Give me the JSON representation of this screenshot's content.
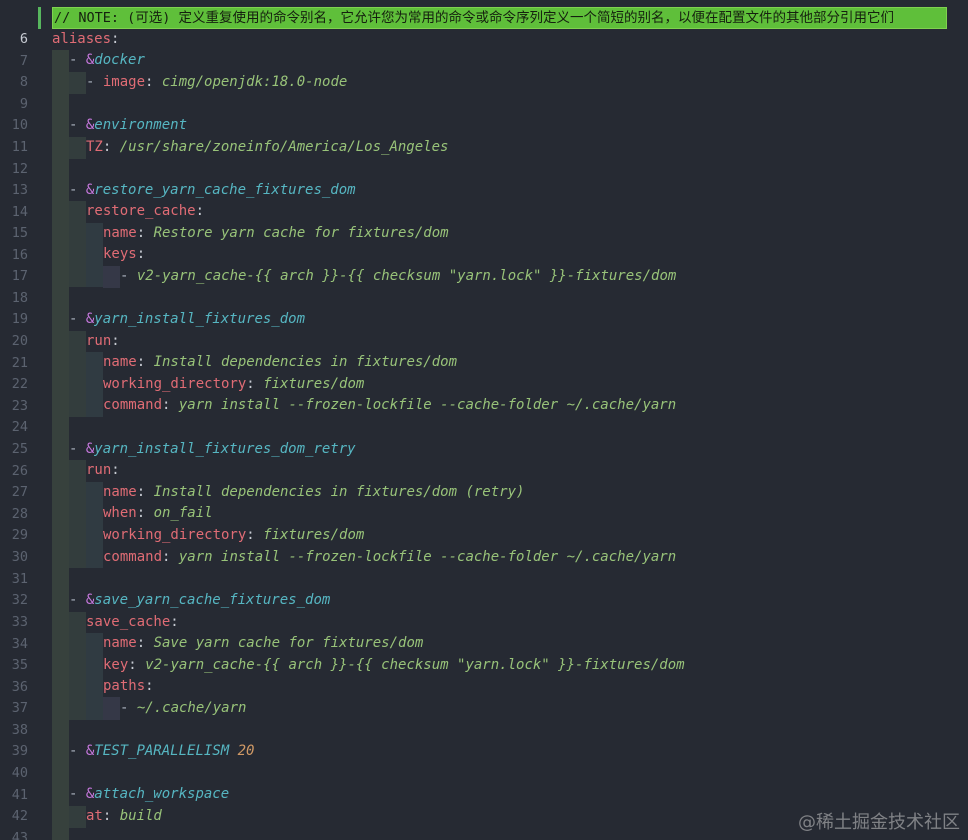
{
  "editor": {
    "note_line": "// NOTE: (可选) 定义重复使用的命令别名，它允许您为常用的命令或命令序列定义一个简短的别名，以便在配置文件的其他部分引用它们",
    "line_numbers": [
      "6",
      "7",
      "8",
      "9",
      "10",
      "11",
      "12",
      "13",
      "14",
      "15",
      "16",
      "17",
      "18",
      "19",
      "20",
      "21",
      "22",
      "23",
      "24",
      "25",
      "26",
      "27",
      "28",
      "29",
      "30",
      "31",
      "32",
      "33",
      "34",
      "35",
      "36",
      "37",
      "38",
      "39",
      "40",
      "41",
      "42",
      "43",
      "44"
    ],
    "colors": {
      "background": "#262a33",
      "key": "#e06c75",
      "anchor_sigil": "#c678dd",
      "anchor_name": "#56b6c2",
      "string": "#98c379",
      "number": "#d19a66",
      "note_highlight": "#5fbf3a"
    }
  },
  "code": {
    "l7": {
      "key": "aliases",
      "colon": ":"
    },
    "l8": {
      "dash": "- ",
      "amp": "&",
      "anchor": "docker"
    },
    "l9": {
      "dash": "- ",
      "key": "image",
      "colon": ": ",
      "value": "cimg/openjdk:18.0-node"
    },
    "l11": {
      "dash": "- ",
      "amp": "&",
      "anchor": "environment"
    },
    "l12": {
      "key": "TZ",
      "colon": ": ",
      "value": "/usr/share/zoneinfo/America/Los_Angeles"
    },
    "l14": {
      "dash": "- ",
      "amp": "&",
      "anchor": "restore_yarn_cache_fixtures_dom"
    },
    "l15": {
      "key": "restore_cache",
      "colon": ":"
    },
    "l16": {
      "key": "name",
      "colon": ": ",
      "value": "Restore yarn cache for fixtures/dom"
    },
    "l17": {
      "key": "keys",
      "colon": ":"
    },
    "l18": {
      "dash": "- ",
      "value": "v2-yarn_cache-{{ arch }}-{{ checksum \"yarn.lock\" }}-fixtures/dom"
    },
    "l20": {
      "dash": "- ",
      "amp": "&",
      "anchor": "yarn_install_fixtures_dom"
    },
    "l21": {
      "key": "run",
      "colon": ":"
    },
    "l22": {
      "key": "name",
      "colon": ": ",
      "value": "Install dependencies in fixtures/dom"
    },
    "l23": {
      "key": "working_directory",
      "colon": ": ",
      "value": "fixtures/dom"
    },
    "l24": {
      "key": "command",
      "colon": ": ",
      "value": "yarn install --frozen-lockfile --cache-folder ~/.cache/yarn"
    },
    "l26": {
      "dash": "- ",
      "amp": "&",
      "anchor": "yarn_install_fixtures_dom_retry"
    },
    "l27": {
      "key": "run",
      "colon": ":"
    },
    "l28": {
      "key": "name",
      "colon": ": ",
      "value": "Install dependencies in fixtures/dom (retry)"
    },
    "l29": {
      "key": "when",
      "colon": ": ",
      "value": "on_fail"
    },
    "l30": {
      "key": "working_directory",
      "colon": ": ",
      "value": "fixtures/dom"
    },
    "l31": {
      "key": "command",
      "colon": ": ",
      "value": "yarn install --frozen-lockfile --cache-folder ~/.cache/yarn"
    },
    "l33": {
      "dash": "- ",
      "amp": "&",
      "anchor": "save_yarn_cache_fixtures_dom"
    },
    "l34": {
      "key": "save_cache",
      "colon": ":"
    },
    "l35": {
      "key": "name",
      "colon": ": ",
      "value": "Save yarn cache for fixtures/dom"
    },
    "l36": {
      "key": "key",
      "colon": ": ",
      "value": "v2-yarn_cache-{{ arch }}-{{ checksum \"yarn.lock\" }}-fixtures/dom"
    },
    "l37": {
      "key": "paths",
      "colon": ":"
    },
    "l38": {
      "dash": "- ",
      "value": "~/.cache/yarn"
    },
    "l40": {
      "dash": "- ",
      "amp": "&",
      "anchor": "TEST_PARALLELISM",
      "space": " ",
      "number": "20"
    },
    "l42": {
      "dash": "- ",
      "amp": "&",
      "anchor": "attach_workspace"
    },
    "l43": {
      "key": "at",
      "colon": ": ",
      "value": "build"
    }
  },
  "watermark": "@稀土掘金技术社区"
}
